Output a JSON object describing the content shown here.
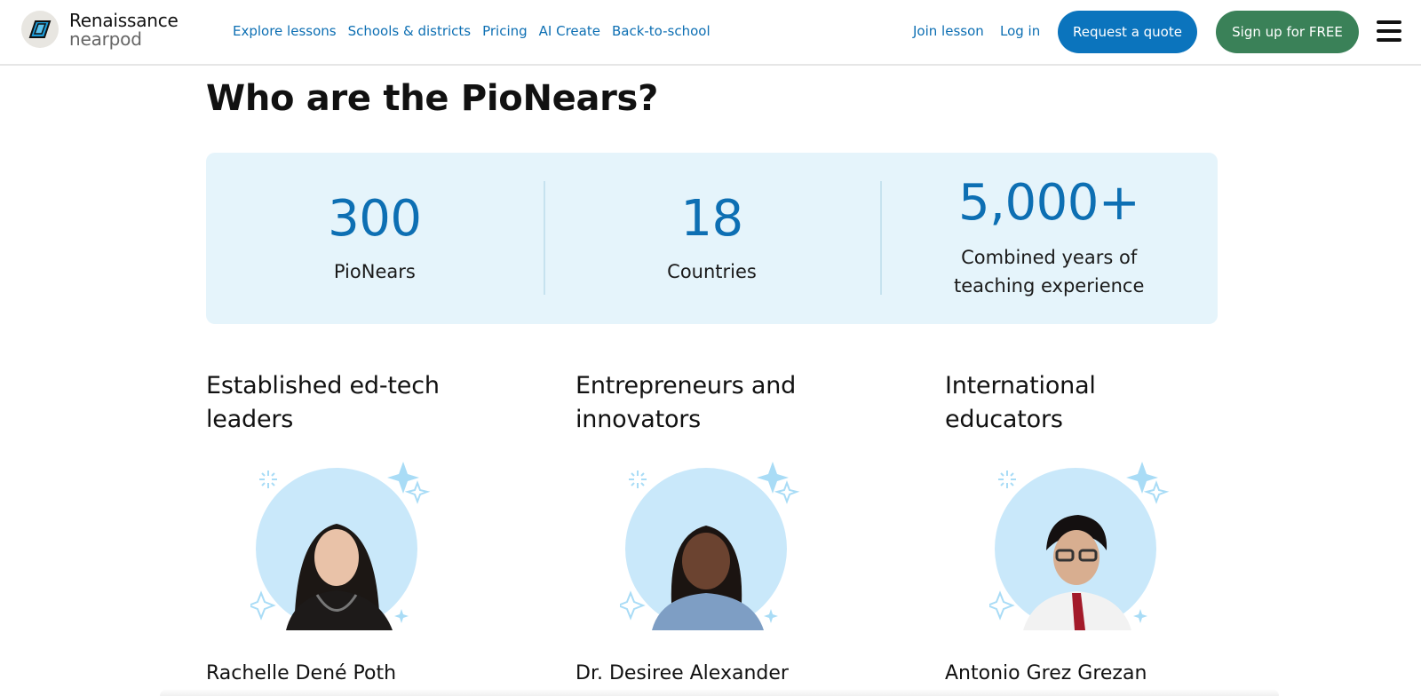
{
  "header": {
    "logo": {
      "top": "Renaissance",
      "bottom": "nearpod",
      "icon": "nearpod-logo-icon"
    },
    "nav": [
      "Explore lessons",
      "Schools & districts",
      "Pricing",
      "AI Create",
      "Back-to-school"
    ],
    "join_label": "Join lesson",
    "login_label": "Log in",
    "quote_label": "Request a quote",
    "signup_label": "Sign up for FREE",
    "menu_icon": "hamburger-menu-icon"
  },
  "main": {
    "title": "Who are the PioNears?",
    "stats": [
      {
        "value": "300",
        "label": "PioNears"
      },
      {
        "value": "18",
        "label": "Countries"
      },
      {
        "value": "5,000+",
        "label_line1": "Combined years of",
        "label_line2": "teaching experience"
      }
    ],
    "columns": [
      {
        "heading_line1": "Established ed-tech",
        "heading_line2": "leaders",
        "person": "Rachelle Dené Poth"
      },
      {
        "heading_line1": "Entrepreneurs and",
        "heading_line2": "innovators",
        "person": "Dr. Desiree Alexander"
      },
      {
        "heading_line1": "International educators",
        "heading_line2": "",
        "person": "Antonio Grez Grezan"
      }
    ]
  },
  "colors": {
    "link_blue": "#0d6fb3",
    "quote_button": "#0b74bd",
    "signup_button": "#3a8158",
    "stats_bg": "#e5f4fb",
    "avatar_circle": "#c9e8fa",
    "sparkle": "#a9dcf6"
  }
}
